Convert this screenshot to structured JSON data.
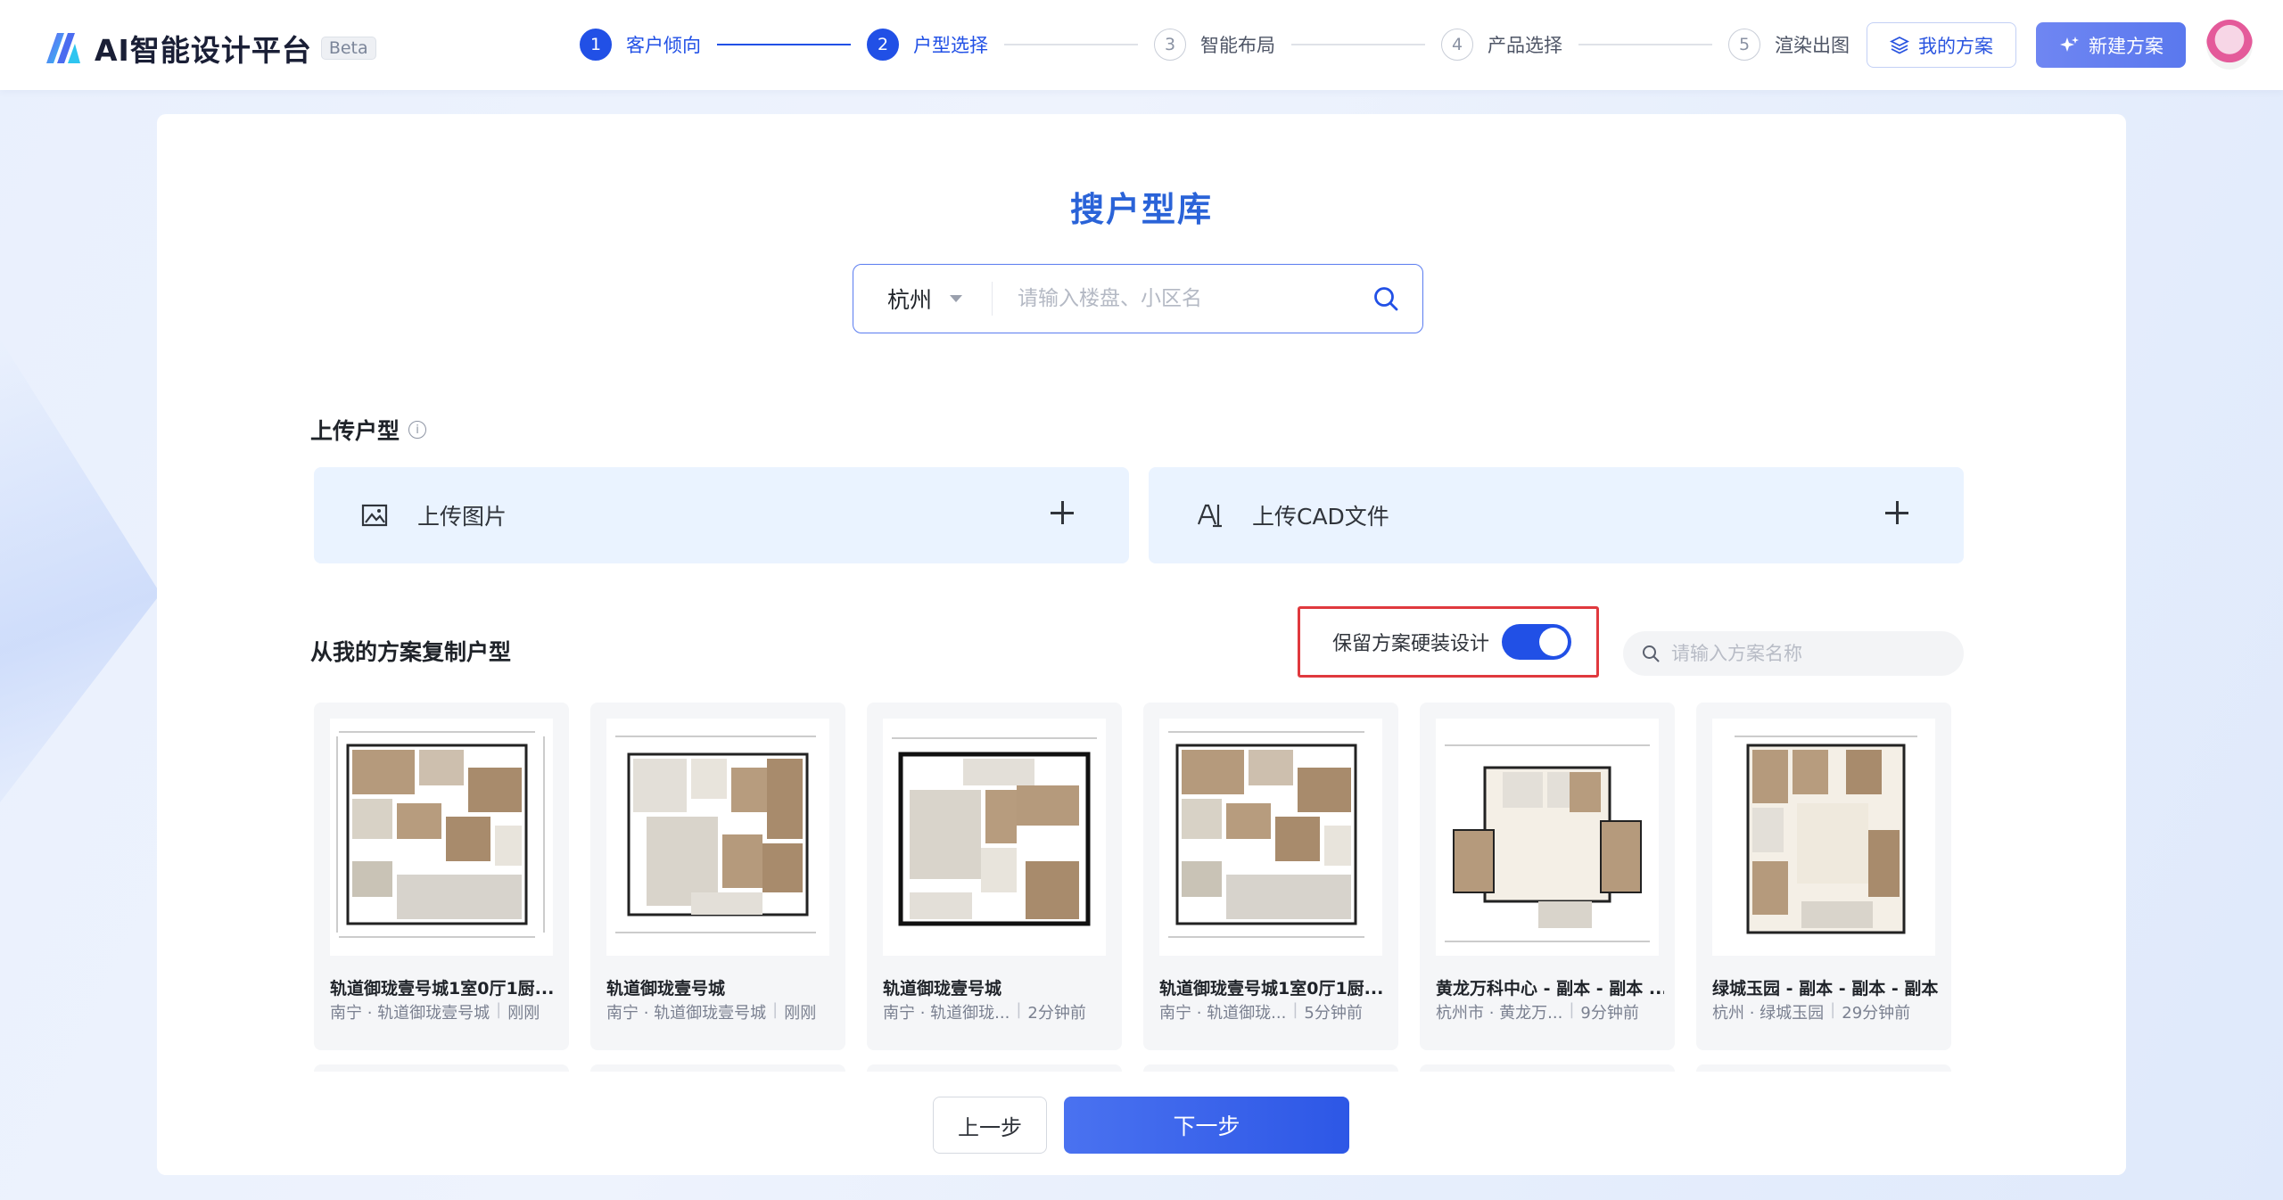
{
  "app": {
    "name": "AI智能设计平台",
    "badge": "Beta"
  },
  "steps": [
    {
      "num": "1",
      "label": "客户倾向",
      "active": true
    },
    {
      "num": "2",
      "label": "户型选择",
      "active": true
    },
    {
      "num": "3",
      "label": "智能布局",
      "active": false
    },
    {
      "num": "4",
      "label": "产品选择",
      "active": false
    },
    {
      "num": "5",
      "label": "渲染出图",
      "active": false
    }
  ],
  "header": {
    "my_plans": "我的方案",
    "new_plan": "新建方案"
  },
  "search": {
    "title": "搜户型库",
    "city": "杭州",
    "placeholder": "请输入楼盘、小区名"
  },
  "upload": {
    "title": "上传户型",
    "image_label": "上传图片",
    "cad_label": "上传CAD文件"
  },
  "copy_section": {
    "title": "从我的方案复制户型",
    "toggle_label": "保留方案硬装设计",
    "toggle_on": true,
    "search_placeholder": "请输入方案名称"
  },
  "plans": [
    {
      "name": "轨道御珑壹号城1室0厅1厨...",
      "loc": "南宁 · 轨道御珑壹号城",
      "time": "刚刚"
    },
    {
      "name": "轨道御珑壹号城",
      "loc": "南宁 · 轨道御珑壹号城",
      "time": "刚刚"
    },
    {
      "name": "轨道御珑壹号城",
      "loc": "南宁 · 轨道御珑...",
      "time": "2分钟前"
    },
    {
      "name": "轨道御珑壹号城1室0厅1厨...",
      "loc": "南宁 · 轨道御珑...",
      "time": "5分钟前"
    },
    {
      "name": "黄龙万科中心 - 副本 - 副本 ...",
      "loc": "杭州市 · 黄龙万...",
      "time": "9分钟前"
    },
    {
      "name": "绿城玉园 - 副本 - 副本 - 副本",
      "loc": "杭州 · 绿城玉园",
      "time": "29分钟前"
    }
  ],
  "footer": {
    "prev": "上一步",
    "next": "下一步"
  },
  "colors": {
    "primary": "#2150e6",
    "title": "#2a63d8",
    "highlight": "#e0393e",
    "upload_bg": "#eaf3ff"
  }
}
